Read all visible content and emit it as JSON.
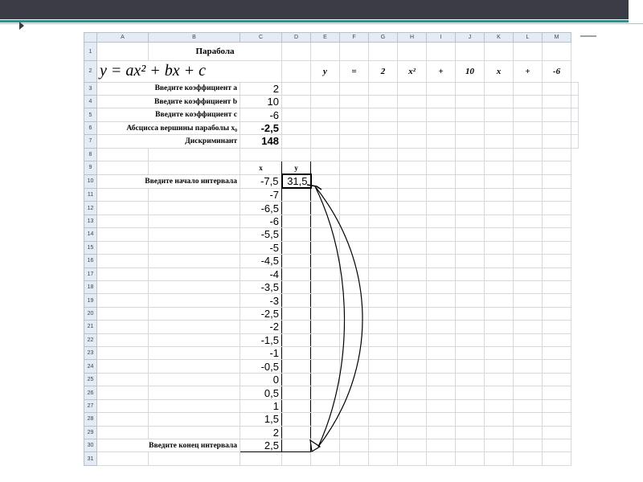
{
  "columns": [
    "A",
    "B",
    "C",
    "D",
    "E",
    "F",
    "G",
    "H",
    "I",
    "J",
    "K",
    "L",
    "M"
  ],
  "rows": [
    "1",
    "2",
    "3",
    "4",
    "5",
    "6",
    "7",
    "8",
    "9",
    "10",
    "11",
    "12",
    "13",
    "14",
    "15",
    "16",
    "17",
    "18",
    "19",
    "20",
    "21",
    "22",
    "23",
    "24",
    "25",
    "26",
    "27",
    "28",
    "29",
    "30",
    "31"
  ],
  "title": "Парабола",
  "formula": "y = ax² + bx + c",
  "equation": {
    "y": "y",
    "eq": "=",
    "a": "2",
    "x2": "x²",
    "plus1": "+",
    "b": "10",
    "x": "x",
    "plus2": "+",
    "c": "-6"
  },
  "params": [
    {
      "label": "Введите коэффициент a",
      "value": "2"
    },
    {
      "label": "Введите коэффициент b",
      "value": "10"
    },
    {
      "label": "Введите коэффициент c",
      "value": "-6"
    },
    {
      "label": "Абсцисса вершины параболы x₀",
      "value": "-2,5"
    },
    {
      "label": "Дискриминант",
      "value": "148"
    }
  ],
  "table_headers": {
    "x": "x",
    "y": "y"
  },
  "interval_start_label": "Введите начало интервала",
  "interval_end_label": "Введите конец интервала",
  "x_values": [
    "-7,5",
    "-7",
    "-6,5",
    "-6",
    "-5,5",
    "-5",
    "-4,5",
    "-4",
    "-3,5",
    "-3",
    "-2,5",
    "-2",
    "-1,5",
    "-1",
    "-0,5",
    "0",
    "0,5",
    "1",
    "1,5",
    "2",
    "2,5"
  ],
  "y_first": "31,5",
  "colors": {
    "top_bar": "#3b3c46",
    "accent": "#2f8e8f",
    "header_bg": "#e4ebf4"
  }
}
